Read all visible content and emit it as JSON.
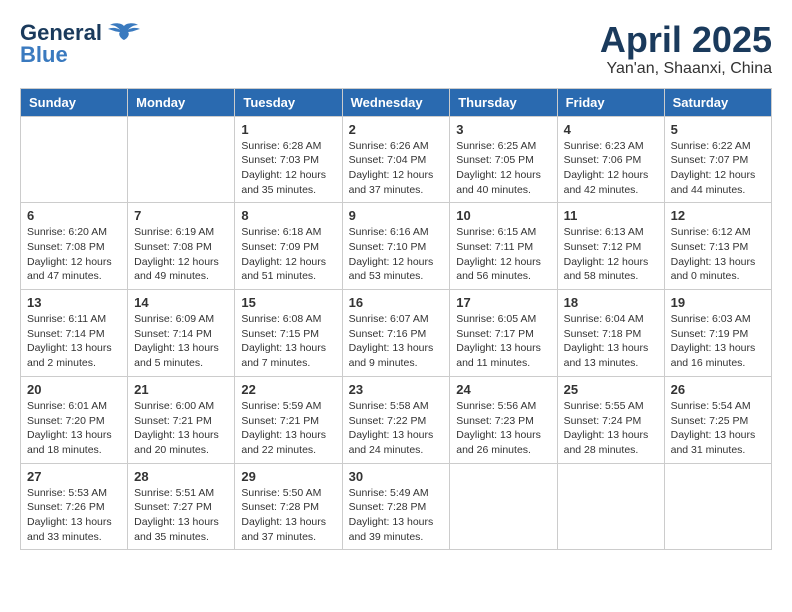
{
  "header": {
    "logo_general": "General",
    "logo_blue": "Blue",
    "month": "April 2025",
    "location": "Yan'an, Shaanxi, China"
  },
  "weekdays": [
    "Sunday",
    "Monday",
    "Tuesday",
    "Wednesday",
    "Thursday",
    "Friday",
    "Saturday"
  ],
  "weeks": [
    [
      {
        "day": "",
        "sunrise": "",
        "sunset": "",
        "daylight": ""
      },
      {
        "day": "",
        "sunrise": "",
        "sunset": "",
        "daylight": ""
      },
      {
        "day": "1",
        "sunrise": "Sunrise: 6:28 AM",
        "sunset": "Sunset: 7:03 PM",
        "daylight": "Daylight: 12 hours and 35 minutes."
      },
      {
        "day": "2",
        "sunrise": "Sunrise: 6:26 AM",
        "sunset": "Sunset: 7:04 PM",
        "daylight": "Daylight: 12 hours and 37 minutes."
      },
      {
        "day": "3",
        "sunrise": "Sunrise: 6:25 AM",
        "sunset": "Sunset: 7:05 PM",
        "daylight": "Daylight: 12 hours and 40 minutes."
      },
      {
        "day": "4",
        "sunrise": "Sunrise: 6:23 AM",
        "sunset": "Sunset: 7:06 PM",
        "daylight": "Daylight: 12 hours and 42 minutes."
      },
      {
        "day": "5",
        "sunrise": "Sunrise: 6:22 AM",
        "sunset": "Sunset: 7:07 PM",
        "daylight": "Daylight: 12 hours and 44 minutes."
      }
    ],
    [
      {
        "day": "6",
        "sunrise": "Sunrise: 6:20 AM",
        "sunset": "Sunset: 7:08 PM",
        "daylight": "Daylight: 12 hours and 47 minutes."
      },
      {
        "day": "7",
        "sunrise": "Sunrise: 6:19 AM",
        "sunset": "Sunset: 7:08 PM",
        "daylight": "Daylight: 12 hours and 49 minutes."
      },
      {
        "day": "8",
        "sunrise": "Sunrise: 6:18 AM",
        "sunset": "Sunset: 7:09 PM",
        "daylight": "Daylight: 12 hours and 51 minutes."
      },
      {
        "day": "9",
        "sunrise": "Sunrise: 6:16 AM",
        "sunset": "Sunset: 7:10 PM",
        "daylight": "Daylight: 12 hours and 53 minutes."
      },
      {
        "day": "10",
        "sunrise": "Sunrise: 6:15 AM",
        "sunset": "Sunset: 7:11 PM",
        "daylight": "Daylight: 12 hours and 56 minutes."
      },
      {
        "day": "11",
        "sunrise": "Sunrise: 6:13 AM",
        "sunset": "Sunset: 7:12 PM",
        "daylight": "Daylight: 12 hours and 58 minutes."
      },
      {
        "day": "12",
        "sunrise": "Sunrise: 6:12 AM",
        "sunset": "Sunset: 7:13 PM",
        "daylight": "Daylight: 13 hours and 0 minutes."
      }
    ],
    [
      {
        "day": "13",
        "sunrise": "Sunrise: 6:11 AM",
        "sunset": "Sunset: 7:14 PM",
        "daylight": "Daylight: 13 hours and 2 minutes."
      },
      {
        "day": "14",
        "sunrise": "Sunrise: 6:09 AM",
        "sunset": "Sunset: 7:14 PM",
        "daylight": "Daylight: 13 hours and 5 minutes."
      },
      {
        "day": "15",
        "sunrise": "Sunrise: 6:08 AM",
        "sunset": "Sunset: 7:15 PM",
        "daylight": "Daylight: 13 hours and 7 minutes."
      },
      {
        "day": "16",
        "sunrise": "Sunrise: 6:07 AM",
        "sunset": "Sunset: 7:16 PM",
        "daylight": "Daylight: 13 hours and 9 minutes."
      },
      {
        "day": "17",
        "sunrise": "Sunrise: 6:05 AM",
        "sunset": "Sunset: 7:17 PM",
        "daylight": "Daylight: 13 hours and 11 minutes."
      },
      {
        "day": "18",
        "sunrise": "Sunrise: 6:04 AM",
        "sunset": "Sunset: 7:18 PM",
        "daylight": "Daylight: 13 hours and 13 minutes."
      },
      {
        "day": "19",
        "sunrise": "Sunrise: 6:03 AM",
        "sunset": "Sunset: 7:19 PM",
        "daylight": "Daylight: 13 hours and 16 minutes."
      }
    ],
    [
      {
        "day": "20",
        "sunrise": "Sunrise: 6:01 AM",
        "sunset": "Sunset: 7:20 PM",
        "daylight": "Daylight: 13 hours and 18 minutes."
      },
      {
        "day": "21",
        "sunrise": "Sunrise: 6:00 AM",
        "sunset": "Sunset: 7:21 PM",
        "daylight": "Daylight: 13 hours and 20 minutes."
      },
      {
        "day": "22",
        "sunrise": "Sunrise: 5:59 AM",
        "sunset": "Sunset: 7:21 PM",
        "daylight": "Daylight: 13 hours and 22 minutes."
      },
      {
        "day": "23",
        "sunrise": "Sunrise: 5:58 AM",
        "sunset": "Sunset: 7:22 PM",
        "daylight": "Daylight: 13 hours and 24 minutes."
      },
      {
        "day": "24",
        "sunrise": "Sunrise: 5:56 AM",
        "sunset": "Sunset: 7:23 PM",
        "daylight": "Daylight: 13 hours and 26 minutes."
      },
      {
        "day": "25",
        "sunrise": "Sunrise: 5:55 AM",
        "sunset": "Sunset: 7:24 PM",
        "daylight": "Daylight: 13 hours and 28 minutes."
      },
      {
        "day": "26",
        "sunrise": "Sunrise: 5:54 AM",
        "sunset": "Sunset: 7:25 PM",
        "daylight": "Daylight: 13 hours and 31 minutes."
      }
    ],
    [
      {
        "day": "27",
        "sunrise": "Sunrise: 5:53 AM",
        "sunset": "Sunset: 7:26 PM",
        "daylight": "Daylight: 13 hours and 33 minutes."
      },
      {
        "day": "28",
        "sunrise": "Sunrise: 5:51 AM",
        "sunset": "Sunset: 7:27 PM",
        "daylight": "Daylight: 13 hours and 35 minutes."
      },
      {
        "day": "29",
        "sunrise": "Sunrise: 5:50 AM",
        "sunset": "Sunset: 7:28 PM",
        "daylight": "Daylight: 13 hours and 37 minutes."
      },
      {
        "day": "30",
        "sunrise": "Sunrise: 5:49 AM",
        "sunset": "Sunset: 7:28 PM",
        "daylight": "Daylight: 13 hours and 39 minutes."
      },
      {
        "day": "",
        "sunrise": "",
        "sunset": "",
        "daylight": ""
      },
      {
        "day": "",
        "sunrise": "",
        "sunset": "",
        "daylight": ""
      },
      {
        "day": "",
        "sunrise": "",
        "sunset": "",
        "daylight": ""
      }
    ]
  ]
}
